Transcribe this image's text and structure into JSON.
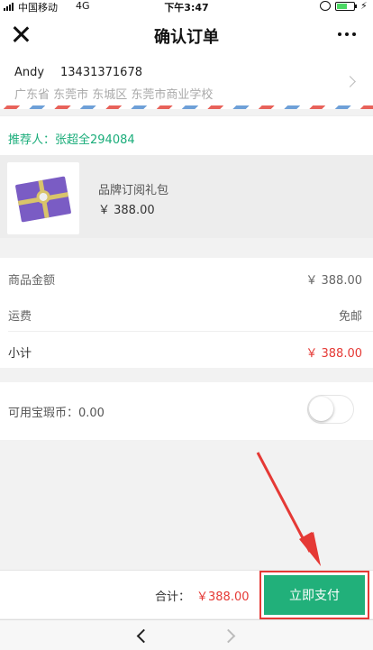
{
  "status_bar": {
    "carrier": "中国移动",
    "network": "4G",
    "time": "下午3:47"
  },
  "nav": {
    "title": "确认订单"
  },
  "address": {
    "name": "Andy",
    "phone": "13431371678",
    "detail": "广东省 东莞市 东城区 东莞市商业学校"
  },
  "referrer": {
    "text": "推荐人：张超全294084"
  },
  "product": {
    "name": "品牌订阅礼包",
    "price": "￥ 388.00"
  },
  "summary": {
    "goods_label": "商品金额",
    "goods_value": "￥ 388.00",
    "shipping_label": "运费",
    "shipping_value": "免邮",
    "subtotal_label": "小计",
    "subtotal_value": "￥ 388.00"
  },
  "coin": {
    "label": "可用宝瑕币：0.00",
    "enabled": false
  },
  "pay_bar": {
    "total_label": "合计：",
    "total_value": "￥388.00",
    "pay_button": "立即支付"
  },
  "colors": {
    "accent_green": "#21b07a",
    "price_red": "#e53935",
    "annotation_red": "#e53935"
  }
}
